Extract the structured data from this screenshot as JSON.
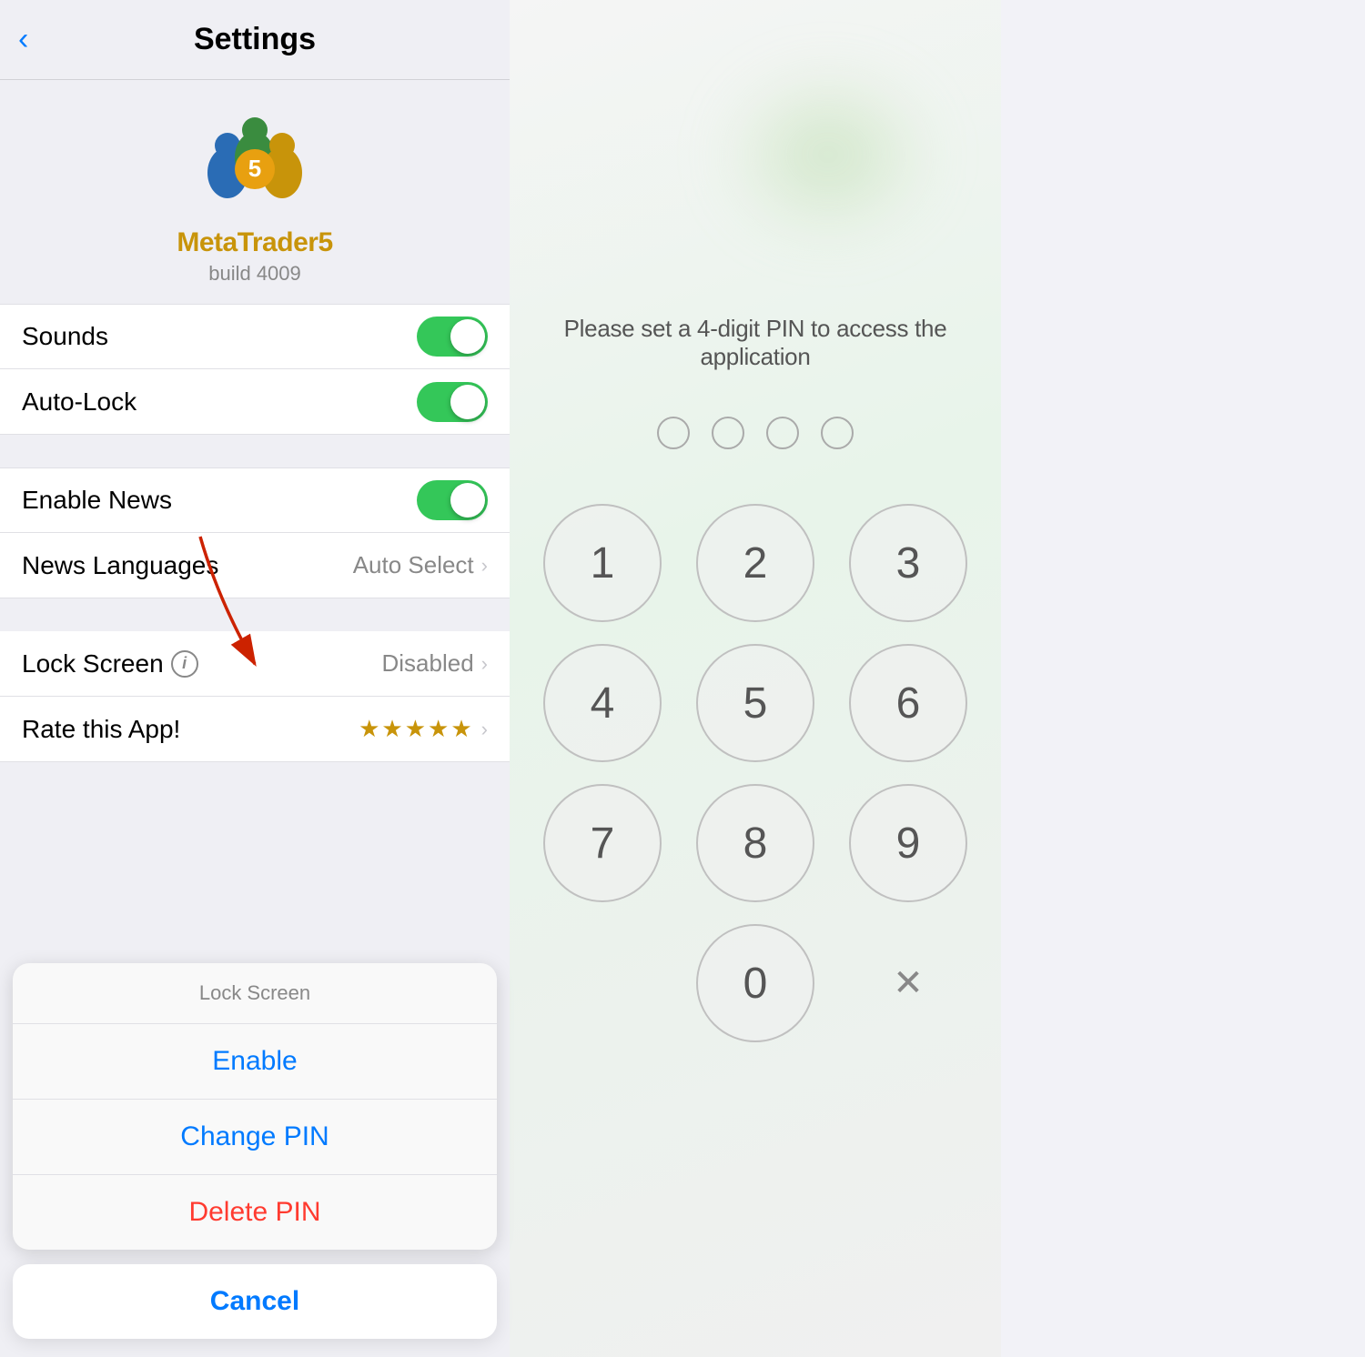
{
  "left": {
    "back_label": "‹",
    "title": "Settings",
    "app_name": "MetaTrader",
    "app_name_number": "5",
    "build": "build 4009",
    "settings": [
      {
        "id": "sounds",
        "label": "Sounds",
        "type": "toggle",
        "enabled": true
      },
      {
        "id": "auto-lock",
        "label": "Auto-Lock",
        "type": "toggle",
        "enabled": true
      }
    ],
    "settings2": [
      {
        "id": "enable-news",
        "label": "Enable News",
        "type": "toggle",
        "enabled": true
      },
      {
        "id": "news-languages",
        "label": "News Languages",
        "type": "detail",
        "value": "Auto Select"
      }
    ],
    "settings3": [
      {
        "id": "lock-screen",
        "label": "Lock Screen",
        "type": "detail-info",
        "value": "Disabled"
      },
      {
        "id": "rate-app",
        "label": "Rate this App!",
        "type": "stars",
        "value": "★★★★★"
      }
    ],
    "action_sheet": {
      "title": "Lock Screen",
      "enable": "Enable",
      "change_pin": "Change PIN",
      "delete_pin": "Delete PIN"
    },
    "cancel_label": "Cancel"
  },
  "right": {
    "prompt": "Please set a 4-digit PIN to access the application",
    "digits": [
      "1",
      "2",
      "3",
      "4",
      "5",
      "6",
      "7",
      "8",
      "9"
    ],
    "zero": "0",
    "delete_label": "✕"
  }
}
